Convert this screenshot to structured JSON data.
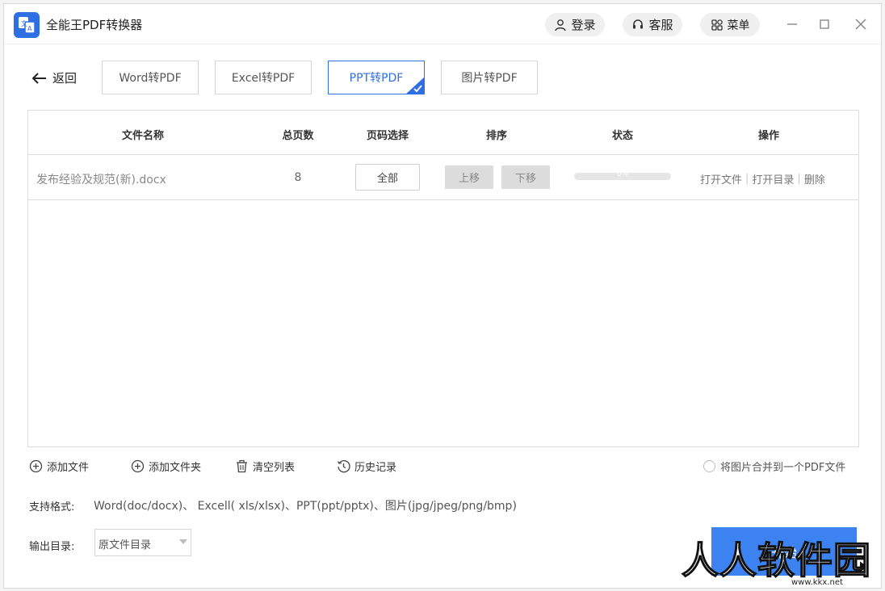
{
  "app": {
    "title": "全能王PDF转换器",
    "logo": "pdf-convert-logo"
  },
  "header": {
    "login_label": "登录",
    "service_label": "客服",
    "menu_label": "菜单"
  },
  "nav": {
    "back_label": "返回",
    "tabs": [
      {
        "label": "Word转PDF",
        "active": false
      },
      {
        "label": "Excel转PDF",
        "active": false
      },
      {
        "label": "PPT转PDF",
        "active": true
      },
      {
        "label": "图片转PDF",
        "active": false
      }
    ]
  },
  "table": {
    "headers": [
      "文件名称",
      "总页数",
      "页码选择",
      "排序",
      "状态",
      "操作"
    ],
    "rows": [
      {
        "name": "发布经验及规范(新).docx",
        "pages": "8",
        "range": "全部",
        "move_up": "上移",
        "move_down": "下移",
        "progress": 0,
        "progress_text": "0%",
        "open_file": "打开文件",
        "open_dir": "打开目录",
        "delete": "删除"
      }
    ]
  },
  "toolbar": {
    "add_file": "添加文件",
    "add_folder": "添加文件夹",
    "clear_list": "清空列表",
    "history": "历史记录",
    "merge_label": "将图片合并到一个PDF文件"
  },
  "footer": {
    "formats_label": "支持格式:",
    "formats_value": "Word(doc/docx)、 Excell( xls/xlsx)、PPT(ppt/pptx)、图片(jpg/jpeg/png/bmp)",
    "output_label": "输出目录:",
    "output_value": "原文件目录",
    "start_label": "开始"
  },
  "watermark": {
    "text": "人人软件园",
    "url": "www.kkx.net"
  },
  "colors": {
    "accent": "#2f6fe4",
    "start_button": "#3c82f0",
    "disabled_button": "#dcdcdc"
  }
}
